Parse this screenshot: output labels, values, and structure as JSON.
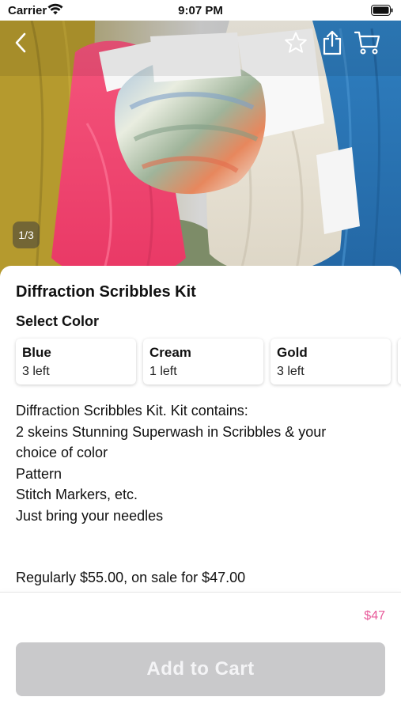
{
  "status_bar": {
    "carrier": "Carrier",
    "time": "9:07 PM"
  },
  "hero": {
    "page_indicator": "1/3",
    "icons": [
      "back-chevron-icon",
      "star-icon",
      "share-icon",
      "cart-icon"
    ]
  },
  "product": {
    "title": "Diffraction Scribbles Kit",
    "select_color_label": "Select Color",
    "colors": [
      {
        "name": "Blue",
        "stock": "3 left"
      },
      {
        "name": "Cream",
        "stock": "1 left"
      },
      {
        "name": "Gold",
        "stock": "3 left"
      }
    ],
    "description_lines": [
      "Diffraction Scribbles Kit. Kit contains:",
      "2 skeins Stunning Superwash in Scribbles & your",
      "choice of color",
      "Pattern",
      "Stitch Markers, etc.",
      "Just bring your needles"
    ],
    "price_note": "Regularly $55.00, on sale for $47.00"
  },
  "footer": {
    "price": "$47",
    "add_to_cart_label": "Add to Cart"
  },
  "colors": {
    "price_accent": "#e85a9a",
    "button_disabled_bg": "#c9c9cb",
    "button_disabled_text": "#f4f4f6"
  }
}
